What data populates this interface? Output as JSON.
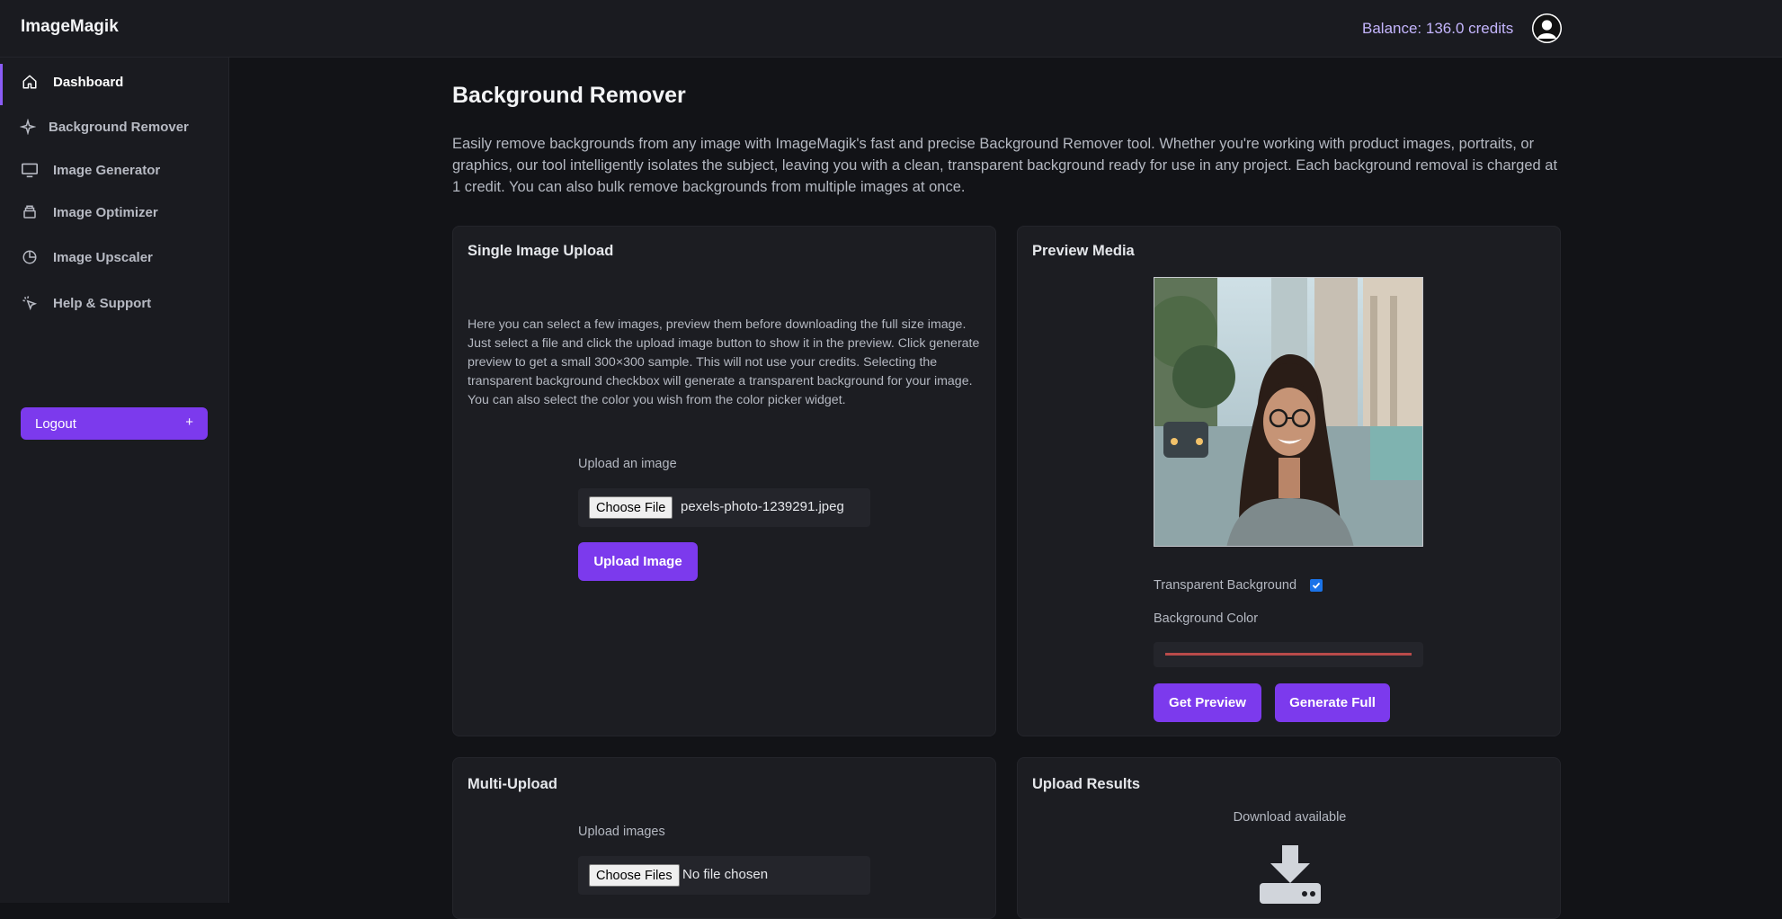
{
  "app": {
    "brand": "ImageMagik",
    "balance": "Balance: 136.0 credits"
  },
  "sidebar": {
    "items": [
      {
        "label": "Dashboard",
        "icon": "home-icon"
      },
      {
        "label": "Background Remover",
        "icon": "sparkle-icon"
      },
      {
        "label": "Image Generator",
        "icon": "monitor-icon"
      },
      {
        "label": "Image Optimizer",
        "icon": "layers-icon"
      },
      {
        "label": "Image Upscaler",
        "icon": "pie-chart-icon"
      },
      {
        "label": "Help & Support",
        "icon": "cursor-click-icon"
      }
    ],
    "logout_label": "Logout",
    "logout_plus": "+"
  },
  "main": {
    "title": "Background Remover",
    "intro": "Easily remove backgrounds from any image with ImageMagik's fast and precise Background Remover tool. Whether you're working with product images, portraits, or graphics, our tool intelligently isolates the subject, leaving you with a clean, transparent background ready for use in any project. Each background removal is charged at 1 credit. You can also bulk remove backgrounds from multiple images at once."
  },
  "single_upload": {
    "title": "Single Image Upload",
    "description": "Here you can select a few images, preview them before downloading the full size image. Just select a file and click the upload image button to show it in the preview. Click generate preview to get a small 300×300 sample. This will not use your credits. Selecting the transparent background checkbox will generate a transparent background for your image. You can also select the color you wish from the color picker widget.",
    "field_label": "Upload an image",
    "choose_label": "Choose File",
    "file_name": "pexels-photo-1239291.jpeg",
    "upload_button": "Upload Image"
  },
  "preview": {
    "title": "Preview Media",
    "transparent_label": "Transparent Background",
    "transparent_checked": true,
    "bg_color_label": "Background Color",
    "bg_color_value": "#b94a4a",
    "get_preview_button": "Get Preview",
    "generate_full_button": "Generate Full"
  },
  "multi_upload": {
    "title": "Multi-Upload",
    "field_label": "Upload images",
    "choose_label": "Choose Files",
    "file_name": "No file chosen"
  },
  "results": {
    "title": "Upload Results",
    "status": "Download available",
    "icon": "download-tray-icon"
  },
  "colors": {
    "accent": "#7c3aed",
    "background": "#121317",
    "panel": "#1c1d22"
  }
}
